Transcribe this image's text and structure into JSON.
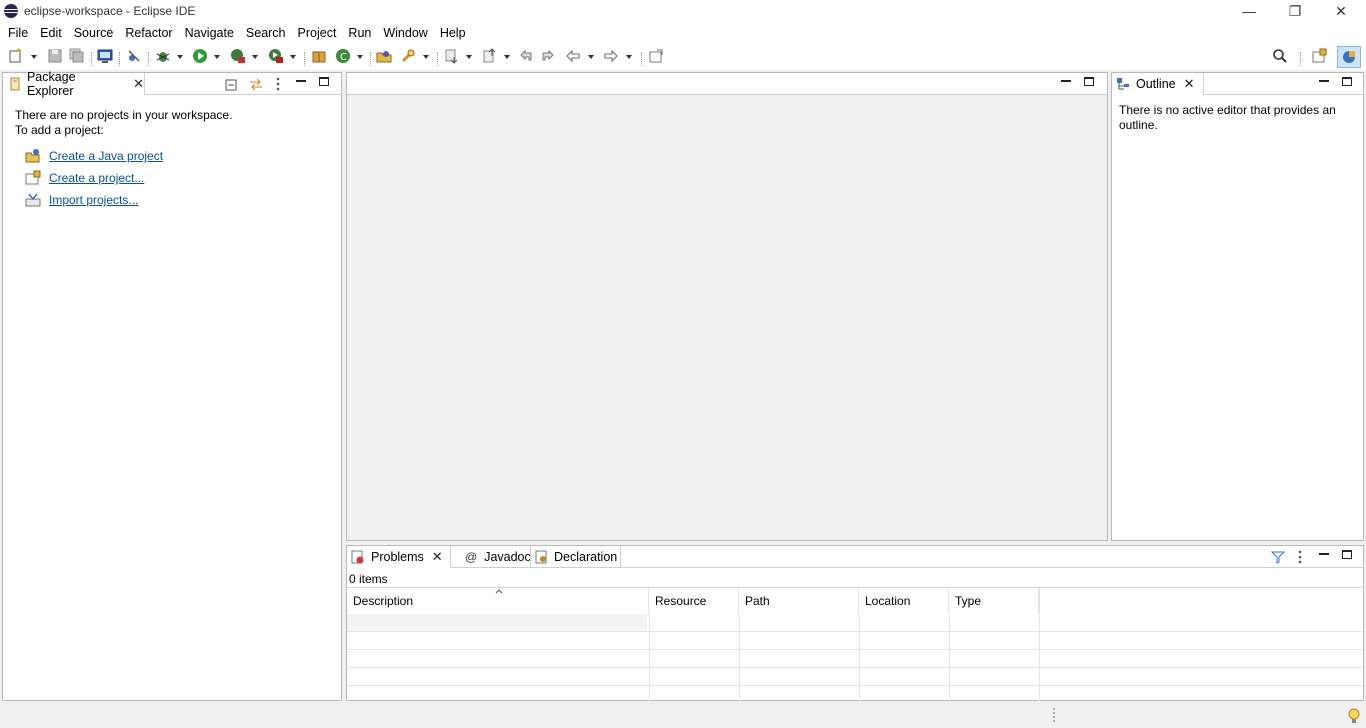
{
  "window": {
    "title": "eclipse-workspace - Eclipse IDE",
    "minimize": "—",
    "restore": "❐",
    "close": "✕"
  },
  "menu": [
    "File",
    "Edit",
    "Source",
    "Refactor",
    "Navigate",
    "Search",
    "Project",
    "Run",
    "Window",
    "Help"
  ],
  "package_explorer": {
    "tab_label": "Package Explorer",
    "message_line1": "There are no projects in your workspace.",
    "message_line2": "To add a project:",
    "links": [
      "Create a Java project",
      "Create a project...",
      "Import projects..."
    ]
  },
  "outline": {
    "tab_label": "Outline",
    "message": "There is no active editor that provides an outline."
  },
  "bottom": {
    "tabs": [
      "Problems",
      "Javadoc",
      "Declaration"
    ],
    "item_count": "0 items",
    "columns": [
      "Description",
      "Resource",
      "Path",
      "Location",
      "Type"
    ]
  },
  "colors": {
    "accent_link": "#0b4fa0",
    "panel_border": "#b8b8b8",
    "background": "#f0f0f0"
  }
}
